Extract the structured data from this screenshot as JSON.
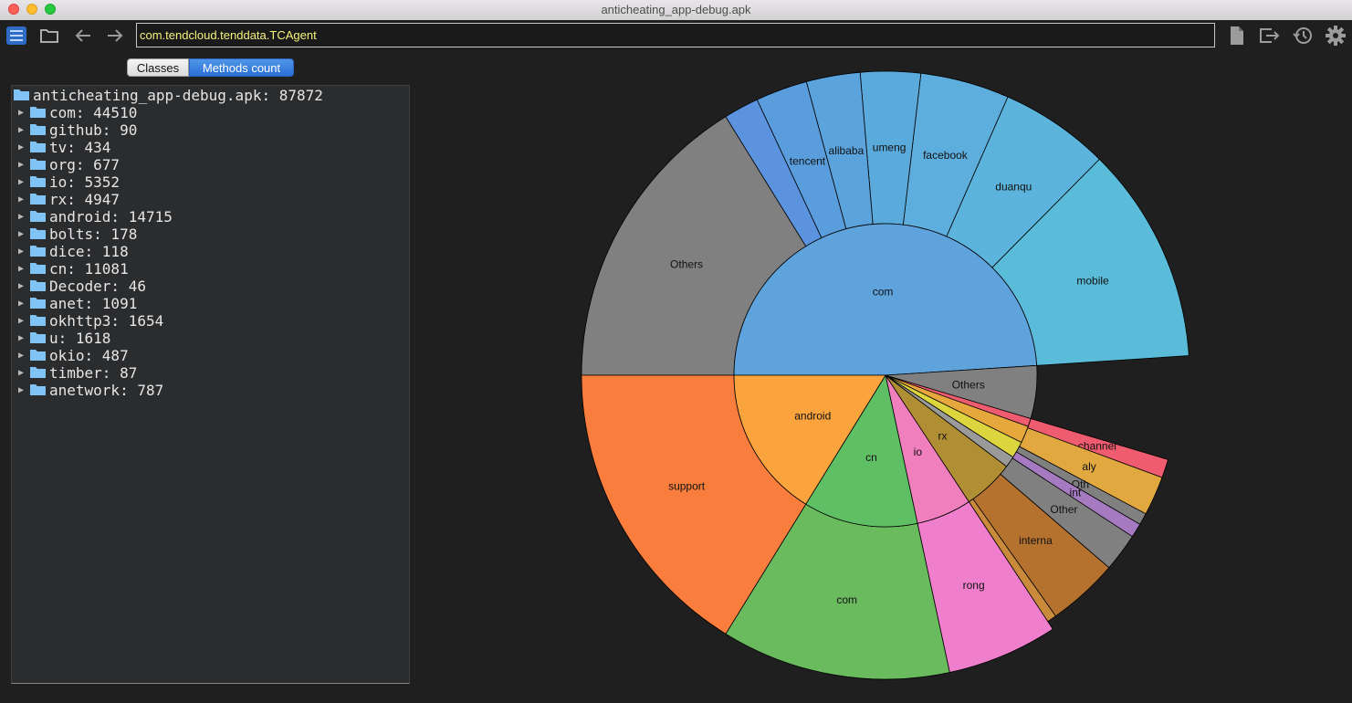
{
  "window": {
    "title": "anticheating_app-debug.apk"
  },
  "toolbar": {
    "search_value": "com.tendcloud.tenddata.TCAgent",
    "icons": [
      "list-view-icon",
      "folder-open-icon",
      "back-arrow-icon",
      "forward-arrow-icon",
      "document-icon",
      "export-icon",
      "history-icon",
      "gear-icon"
    ]
  },
  "tabs": {
    "classes": "Classes",
    "methods_count": "Methods count",
    "active": "methods_count"
  },
  "tree": {
    "root": "anticheating_app-debug.apk: 87872",
    "items": [
      "com: 44510",
      "github: 90",
      "tv: 434",
      "org: 677",
      "io: 5352",
      "rx: 4947",
      "android: 14715",
      "bolts: 178",
      "dice: 118",
      "cn: 11081",
      "Decoder: 46",
      "anet: 1091",
      "okhttp3: 1654",
      "u: 1618",
      "okio: 487",
      "timber: 87",
      "anetwork: 787"
    ]
  },
  "chart_data": {
    "type": "sunburst",
    "colors": {
      "blue": "#5fa3dc",
      "orange": "#fba33c",
      "green": "#5fbf64",
      "pink": "#ef7fbd",
      "olive": "#b08f34",
      "gray": "#808080"
    },
    "inner": [
      {
        "name": "com",
        "value": 44510,
        "color": "#5fa3dc"
      },
      {
        "name": "Others",
        "value": 5128,
        "color": "#808080"
      },
      {
        "name": "",
        "value": 787,
        "color": "#ef5b6f"
      },
      {
        "name": "",
        "value": 1654,
        "color": "#e6a83d"
      },
      {
        "name": "",
        "value": 1618,
        "color": "#ddd53e"
      },
      {
        "name": "",
        "value": 1091,
        "color": "#9a9a9a"
      },
      {
        "name": "rx",
        "value": 4947,
        "color": "#b08f34"
      },
      {
        "name": "io",
        "value": 5352,
        "color": "#ef7fbd"
      },
      {
        "name": "cn",
        "value": 11081,
        "color": "#5fbf64"
      },
      {
        "name": "android",
        "value": 14715,
        "color": "#fba33c"
      }
    ],
    "outer": [
      {
        "parent": "com",
        "name": "mobile",
        "value": 10500,
        "color": "#5bbcd9"
      },
      {
        "parent": "com",
        "name": "duanqu",
        "value": 5300,
        "color": "#5cb3db"
      },
      {
        "parent": "com",
        "name": "facebook",
        "value": 4300,
        "color": "#5daedc"
      },
      {
        "parent": "com",
        "name": "umeng",
        "value": 2900,
        "color": "#5aaadb"
      },
      {
        "parent": "com",
        "name": "alibaba",
        "value": 2600,
        "color": "#5aa3dd"
      },
      {
        "parent": "com",
        "name": "tencent",
        "value": 2500,
        "color": "#5a9ddd"
      },
      {
        "parent": "com",
        "name": "",
        "value": 1700,
        "color": "#5b93df"
      },
      {
        "parent": "com",
        "name": "Others",
        "value": 14710,
        "color": "#808080"
      },
      {
        "parent": "",
        "name": "channel",
        "value": 787,
        "color": "#ef5b6f"
      },
      {
        "parent": "",
        "name": "aly",
        "value": 1654,
        "color": "#e0a83f"
      },
      {
        "parent": "",
        "name": "Oth",
        "value": 500,
        "color": "#808080"
      },
      {
        "parent": "",
        "name": "int",
        "value": 600,
        "color": "#a57ac0"
      },
      {
        "parent": "",
        "name": "Other",
        "value": 1618,
        "color": "#808080"
      },
      {
        "parent": "",
        "name": "interna",
        "value": 3000,
        "color": "#b4722e"
      },
      {
        "parent": "",
        "name": "",
        "value": 400,
        "color": "#c98a3c"
      },
      {
        "parent": "io",
        "name": "rong",
        "value": 5352,
        "color": "#ef7fcd"
      },
      {
        "parent": "cn",
        "name": "com",
        "value": 11081,
        "color": "#6aba5e"
      },
      {
        "parent": "android",
        "name": "support",
        "value": 14715,
        "color": "#f97d3c"
      }
    ]
  }
}
